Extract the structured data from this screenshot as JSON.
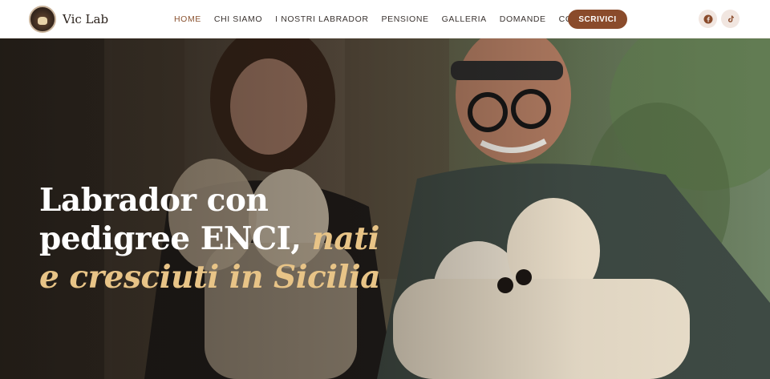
{
  "brand": {
    "name": "Vic Lab",
    "logo_icon": "dog-logo-icon"
  },
  "nav": {
    "items": [
      {
        "label": "HOME",
        "active": true
      },
      {
        "label": "CHI SIAMO",
        "active": false
      },
      {
        "label": "I NOSTRI LABRADOR",
        "active": false
      },
      {
        "label": "PENSIONE",
        "active": false
      },
      {
        "label": "GALLERIA",
        "active": false
      },
      {
        "label": "DOMANDE",
        "active": false
      },
      {
        "label": "CONTATTI",
        "active": false
      }
    ],
    "cta_label": "SCRIVICI"
  },
  "social": [
    {
      "icon": "facebook-icon"
    },
    {
      "icon": "tiktok-icon"
    }
  ],
  "hero": {
    "title_plain": "Labrador con pedigree ENCI,",
    "title_accent": "nati e cresciuti in Sicilia"
  },
  "colors": {
    "accent": "#8a4b2b",
    "nav_active": "#8a5331",
    "hero_accent": "#e8c487"
  }
}
